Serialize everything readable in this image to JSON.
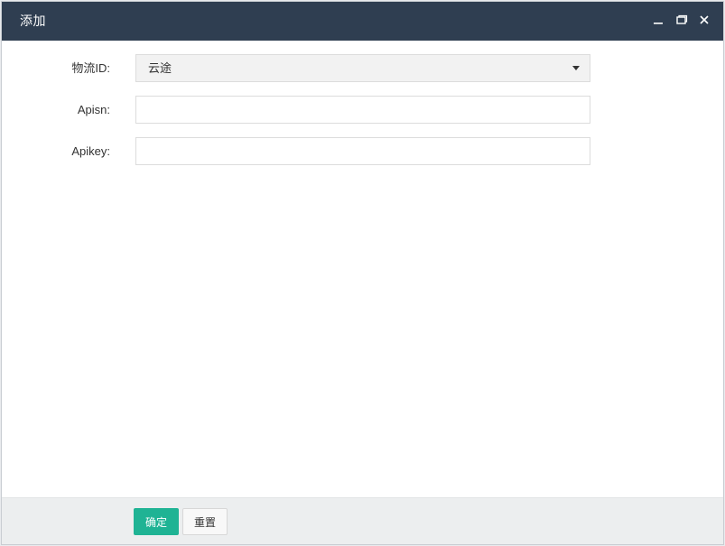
{
  "dialog": {
    "title": "添加"
  },
  "window_controls": {
    "minimize_icon": "minimize-icon",
    "maximize_icon": "maximize-icon",
    "close_icon": "close-icon"
  },
  "form": {
    "logistics_id": {
      "label": "物流ID:",
      "selected": "云途"
    },
    "apisn": {
      "label": "Apisn:",
      "value": "",
      "placeholder": ""
    },
    "apikey": {
      "label": "Apikey:",
      "value": "",
      "placeholder": ""
    }
  },
  "footer": {
    "confirm_label": "确定",
    "reset_label": "重置"
  },
  "colors": {
    "titlebar": "#2f3e51",
    "primary": "#1fb394",
    "footer_bg": "#eceeef"
  }
}
